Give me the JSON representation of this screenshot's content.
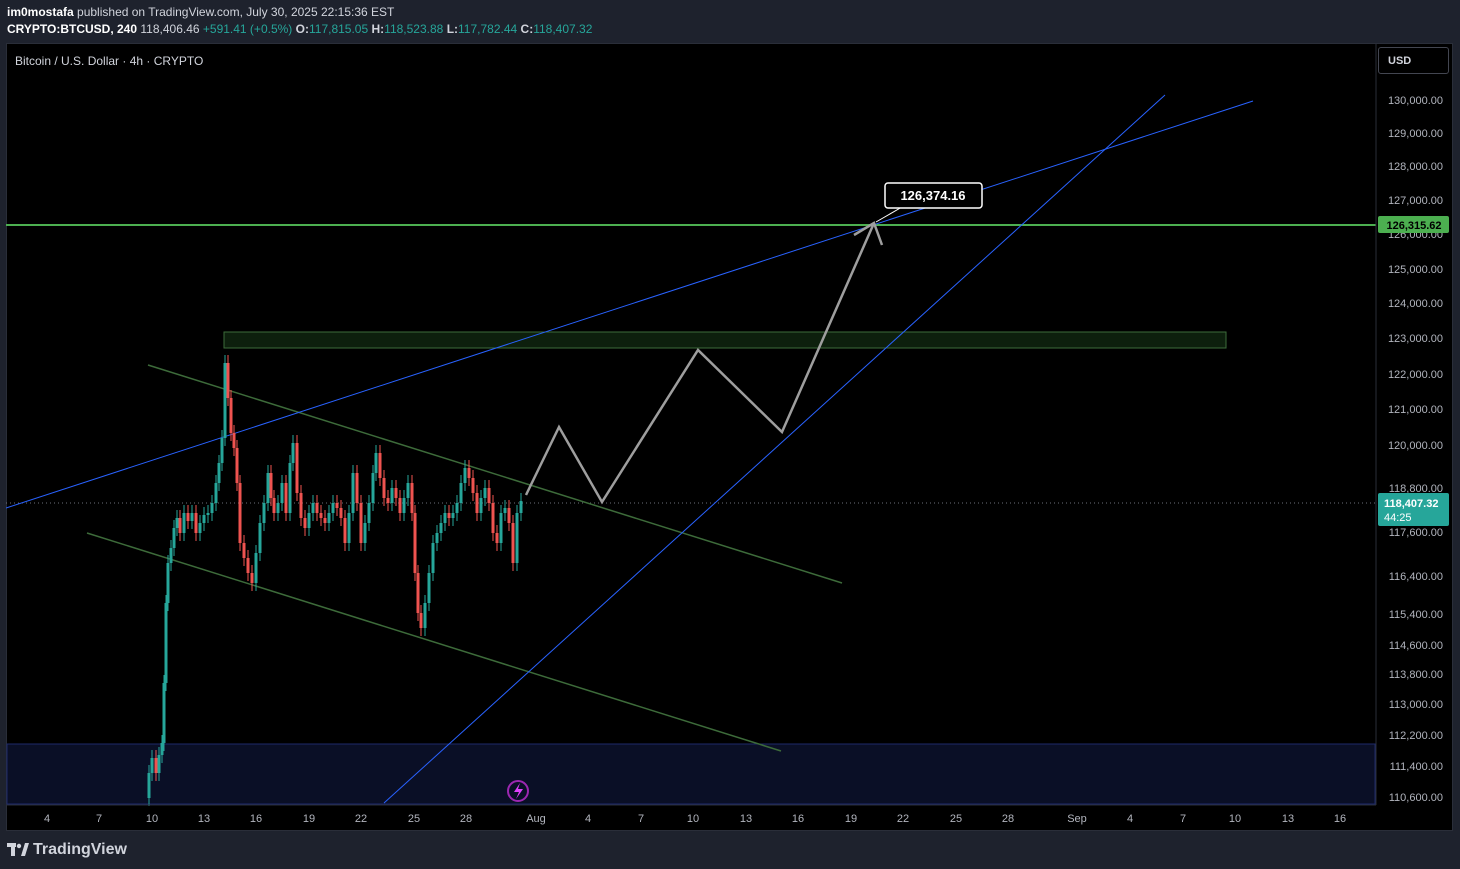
{
  "header": {
    "author": "im0mostafa",
    "published": " published on TradingView.com, July 30, 2025 22:15:36 EST",
    "symbol": "CRYPTO:BTCUSD, 240",
    "price": "118,406.46",
    "change": "+591.41 (+0.5%)",
    "o_label": "O:",
    "o": "117,815.05",
    "h_label": "H:",
    "h": "118,523.88",
    "l_label": "L:",
    "l": "117,782.44",
    "c_label": "C:",
    "c": "118,407.32"
  },
  "legend": {
    "title": "Bitcoin / U.S. Dollar · 4h · CRYPTO"
  },
  "currency_button": "USD",
  "footer": {
    "brand": "TradingView"
  },
  "colors": {
    "up": "#26a69a",
    "down": "#ef5350",
    "blue_line": "#2962ff",
    "green_line": "#4caf50",
    "channel": "#3d6b3a",
    "path": "#9e9e9e"
  },
  "chart_data": {
    "type": "candlestick",
    "price_axis_ticks": [
      "130,000.00",
      "129,000.00",
      "128,000.00",
      "127,000.00",
      "126,000.00",
      "125,000.00",
      "124,000.00",
      "123,000.00",
      "122,000.00",
      "121,000.00",
      "120,000.00",
      "118,800.00",
      "117,600.00",
      "116,400.00",
      "115,400.00",
      "114,600.00",
      "113,800.00",
      "113,000.00",
      "112,200.00",
      "111,400.00",
      "110,600.00"
    ],
    "time_axis_ticks": [
      "4",
      "7",
      "10",
      "13",
      "16",
      "19",
      "22",
      "25",
      "28",
      "Aug",
      "4",
      "7",
      "10",
      "13",
      "16",
      "19",
      "22",
      "25",
      "28",
      "Sep",
      "4",
      "7",
      "10",
      "13",
      "16"
    ],
    "last_price_label": "118,407.32",
    "countdown": "44:25",
    "horizontal_level_label": "126,315.62",
    "target_label": "126,374.16"
  }
}
